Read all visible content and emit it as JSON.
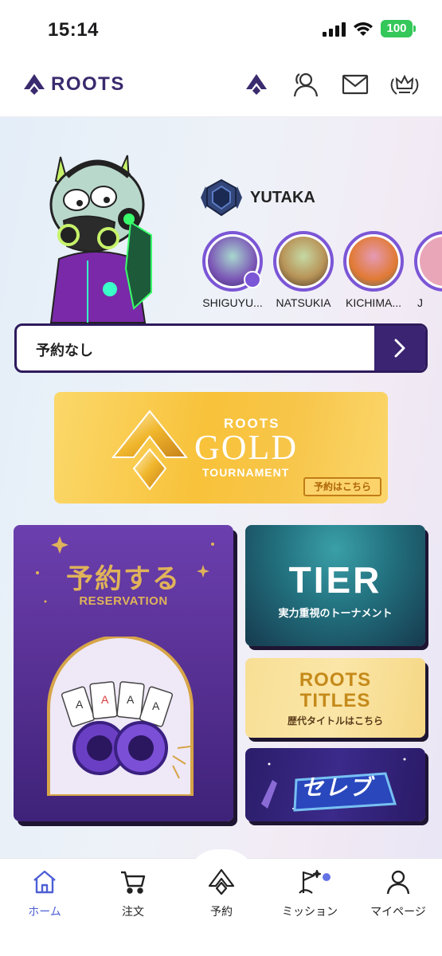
{
  "status_bar": {
    "time": "15:14",
    "battery": "100"
  },
  "header": {
    "logo_text": "ROOTS",
    "icons": [
      "spade-icon",
      "friends-icon",
      "mail-icon",
      "crown-icon"
    ]
  },
  "profile": {
    "player_name": "YUTAKA",
    "friends": [
      {
        "name": "SHIGUYU..."
      },
      {
        "name": "NATSUKIA"
      },
      {
        "name": "KICHIMA..."
      },
      {
        "name": "J"
      }
    ]
  },
  "reservation_bar": {
    "label": "予約なし"
  },
  "gold_banner": {
    "brand": "ROOTS",
    "title": "GOLD",
    "subtitle": "TOURNAMENT",
    "button": "予約はこちら"
  },
  "cards": {
    "reserve": {
      "title": "予約する",
      "subtitle": "RESERVATION"
    },
    "tier": {
      "title": "TIER",
      "subtitle": "実力重視のトーナメント"
    },
    "titles": {
      "line1": "ROOTS",
      "line2": "TITLES",
      "subtitle": "歴代タイトルはこちら"
    },
    "celeb": {
      "logo": "セレブ"
    }
  },
  "tabbar": {
    "items": [
      {
        "label": "ホーム",
        "active": true
      },
      {
        "label": "注文",
        "active": false
      },
      {
        "label": "予約",
        "active": false
      },
      {
        "label": "ミッション",
        "active": false
      },
      {
        "label": "マイページ",
        "active": false
      }
    ]
  },
  "colors": {
    "accent": "#3a2a6e",
    "active_tab": "#4e5fd6",
    "gold": "#f8c23a",
    "purple": "#5a3296"
  }
}
